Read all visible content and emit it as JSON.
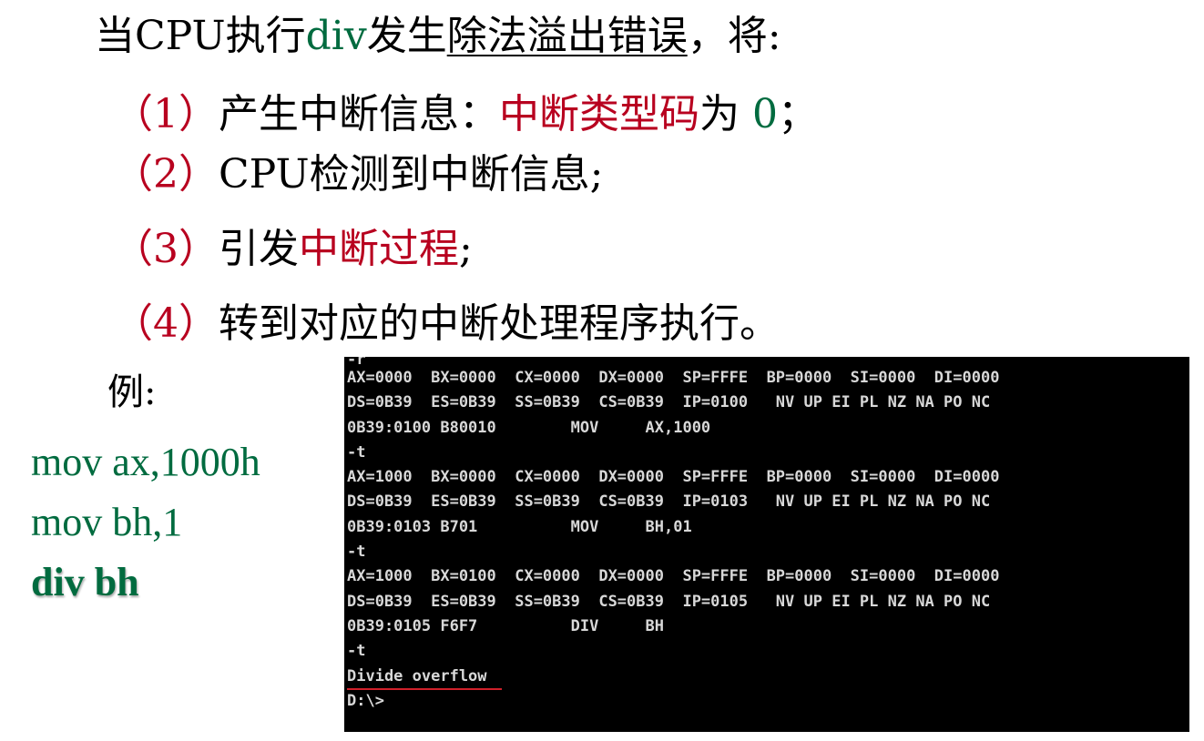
{
  "intro": {
    "prefix": "当CPU执行",
    "div": "div",
    "mid": "发生",
    "underlined": "除法溢出错误",
    "suffix": "，将:"
  },
  "items": {
    "one": {
      "num": "（1）",
      "text1": "产生中断信息：",
      "red": "中断类型码",
      "text2": "为",
      "zero": " 0",
      "text3": "；"
    },
    "two": {
      "num": "（2）",
      "text": "CPU检测到中断信息;"
    },
    "three": {
      "num": "（3）",
      "text1": "引发",
      "red": "中断过程",
      "text2": ";"
    },
    "four": {
      "num": "（4）",
      "text": "转到对应的中断处理程序执行。"
    }
  },
  "example": {
    "label": "例:",
    "code": [
      "mov ax,1000h",
      "mov bh,1",
      "div bh"
    ]
  },
  "console": {
    "lines": [
      "-r",
      "AX=0000  BX=0000  CX=0000  DX=0000  SP=FFFE  BP=0000  SI=0000  DI=0000",
      "DS=0B39  ES=0B39  SS=0B39  CS=0B39  IP=0100   NV UP EI PL NZ NA PO NC",
      "0B39:0100 B80010        MOV     AX,1000",
      "-t",
      "AX=1000  BX=0000  CX=0000  DX=0000  SP=FFFE  BP=0000  SI=0000  DI=0000",
      "DS=0B39  ES=0B39  SS=0B39  CS=0B39  IP=0103   NV UP EI PL NZ NA PO NC",
      "0B39:0103 B701          MOV     BH,01",
      "-t",
      "AX=1000  BX=0100  CX=0000  DX=0000  SP=FFFE  BP=0000  SI=0000  DI=0000",
      "DS=0B39  ES=0B39  SS=0B39  CS=0B39  IP=0105   NV UP EI PL NZ NA PO NC",
      "0B39:0105 F6F7          DIV     BH",
      "-t",
      "Divide overflow",
      "D:\\>"
    ]
  },
  "colors": {
    "green": "#006b3f",
    "red": "#b8001f",
    "console_bg": "#000000",
    "console_text": "#d8d8d8",
    "underline_red": "#d0202a"
  }
}
